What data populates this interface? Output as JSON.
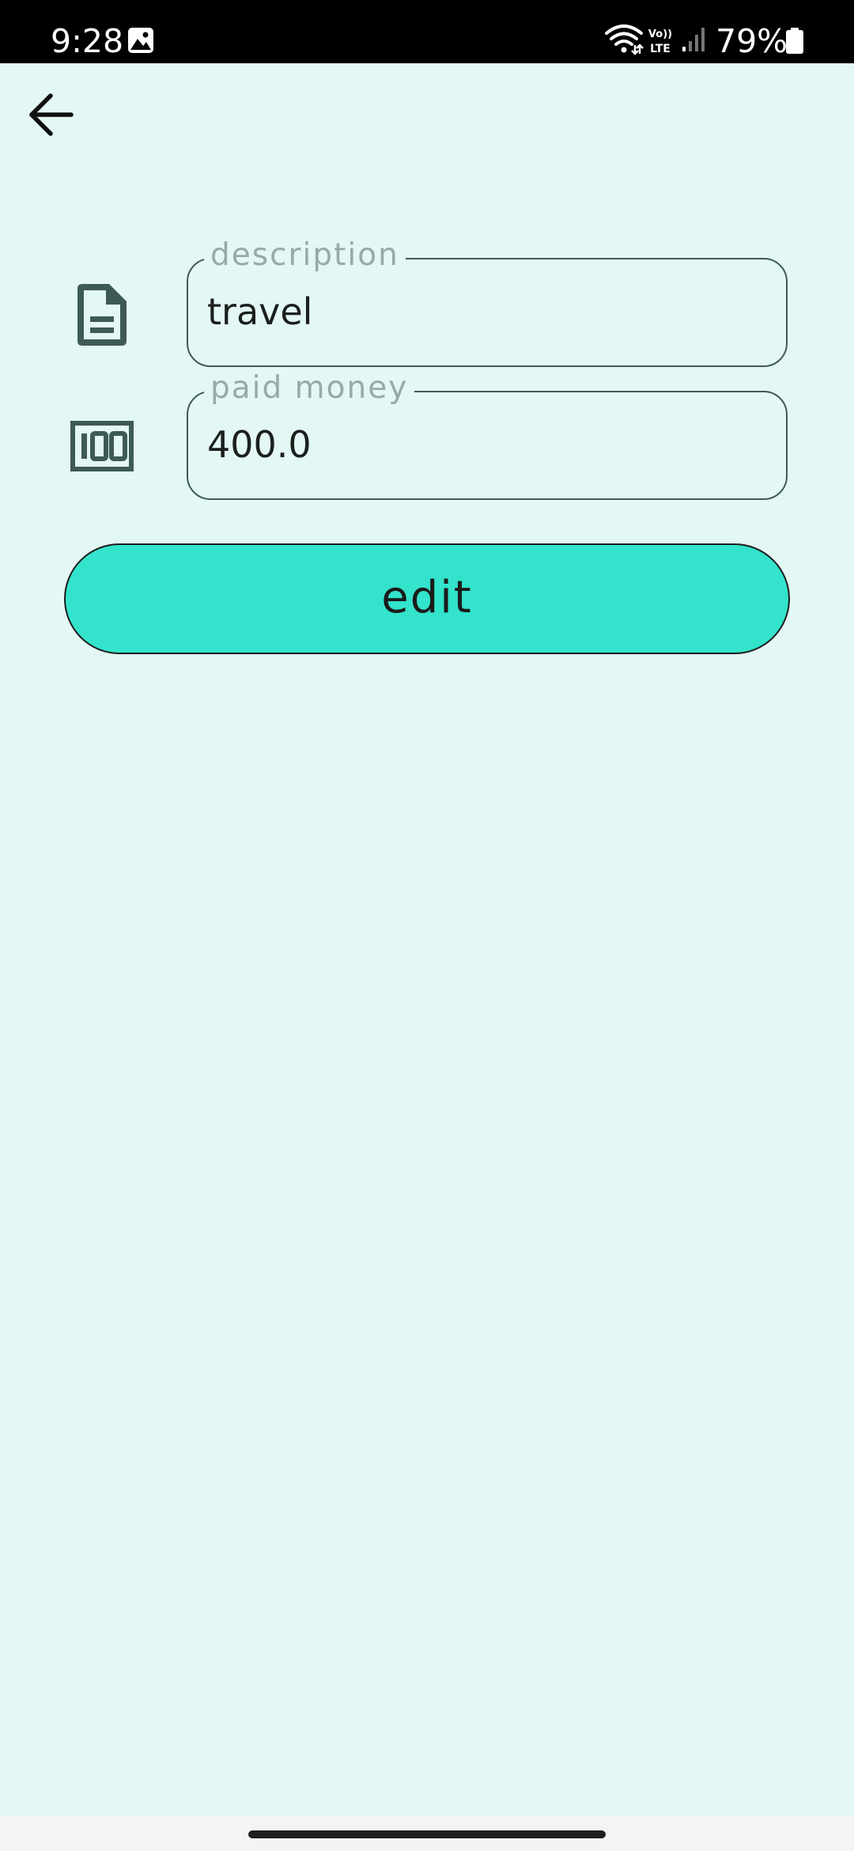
{
  "status_bar": {
    "time": "9:28",
    "battery_percent": "79%",
    "lte_top": "Vo))",
    "lte_bottom": "LTE",
    "icons": [
      "gallery-icon",
      "wifi-icon",
      "volte-lte-icon",
      "signal-icon",
      "battery-icon"
    ]
  },
  "top_bar": {
    "back_icon": "arrow-left-icon"
  },
  "form": {
    "description": {
      "label": "description",
      "value": "travel",
      "icon": "document-icon"
    },
    "paid_money": {
      "label": "paid money",
      "value": "400.0",
      "icon": "money-100-icon"
    },
    "edit_button_label": "edit"
  },
  "colors": {
    "background": "#e3f7f4",
    "accent": "#33e3cc",
    "icon": "#3e5a54",
    "field_border": "#3e5a54",
    "label": "#97aaa6"
  }
}
